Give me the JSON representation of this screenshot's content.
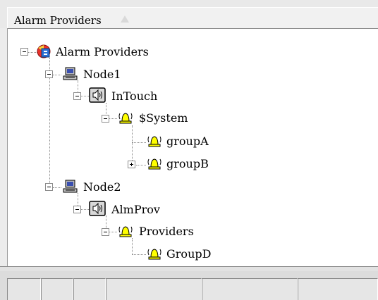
{
  "header": {
    "title": "Alarm Providers",
    "sort_icon": "sort-ascending-triangle"
  },
  "tree": {
    "root": {
      "label": "Alarm Providers",
      "icon": "alarm-providers-icon",
      "expanded": true
    },
    "nodes": [
      {
        "label": "Node1",
        "icon": "computer-icon",
        "expanded": true
      },
      {
        "label": "InTouch",
        "icon": "speaker-icon",
        "expanded": true
      },
      {
        "label": "$System",
        "icon": "alarm-bell-icon",
        "expanded": true
      },
      {
        "label": "groupA",
        "icon": "alarm-bell-icon",
        "expanded": null
      },
      {
        "label": "groupB",
        "icon": "alarm-bell-icon",
        "expanded": false
      },
      {
        "label": "Node2",
        "icon": "computer-icon",
        "expanded": true
      },
      {
        "label": "AlmProv",
        "icon": "speaker-icon",
        "expanded": true
      },
      {
        "label": "Providers",
        "icon": "alarm-bell-icon",
        "expanded": true
      },
      {
        "label": "GroupD",
        "icon": "alarm-bell-icon",
        "expanded": null
      }
    ]
  },
  "colors": {
    "bell": "#ffff00",
    "root_icon_red": "#e8312a",
    "root_icon_blue": "#2a6fd6",
    "computer": "#3a4fb0"
  }
}
